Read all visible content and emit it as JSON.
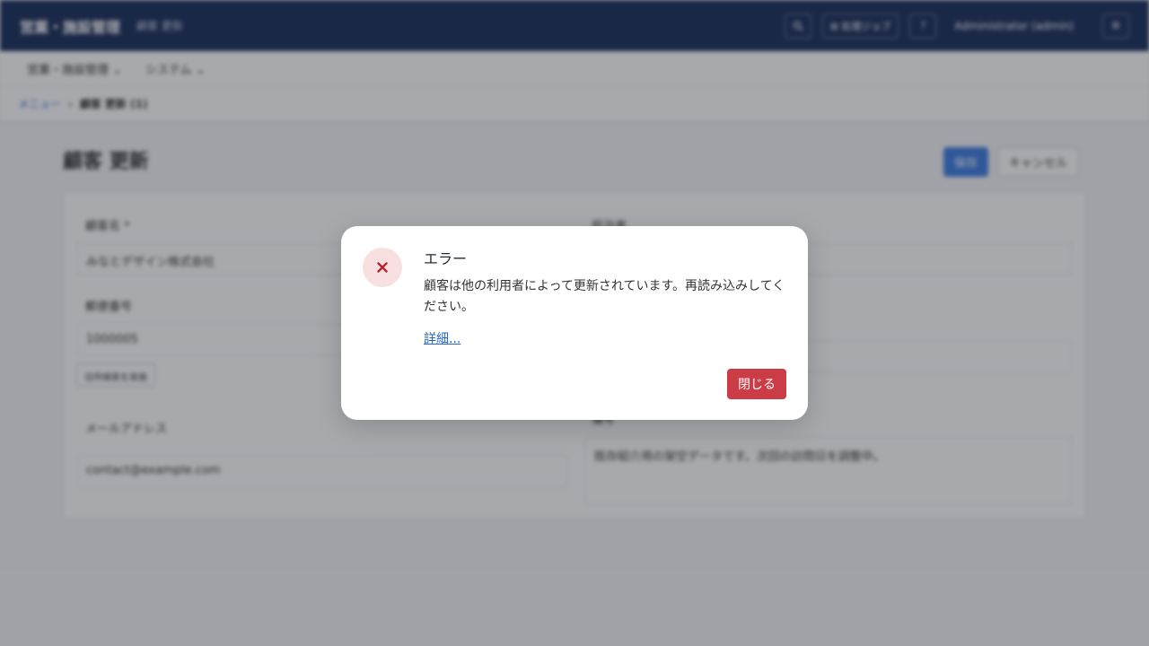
{
  "header": {
    "brand": "営業・施設管理",
    "subtitle": "顧客 更新",
    "search_icon": "search-icon",
    "jobs_label": "⊞ 処理ジョブ",
    "help_label": "?",
    "user_label": "Administrator (admin)",
    "menu_icon": "gear-icon"
  },
  "nav": {
    "items": [
      {
        "label": "営業・施設管理 ⌄"
      },
      {
        "label": "システム ⌄"
      }
    ]
  },
  "breadcrumb": {
    "root": "メニュー",
    "current": "顧客 更新 (1)"
  },
  "page": {
    "title": "顧客 更新",
    "save_label": "保存",
    "cancel_label": "キャンセル"
  },
  "form": {
    "customer_name_label": "顧客名 *",
    "customer_name_value": "みなとデザイン株式会社",
    "postal_label": "郵便番号",
    "postal_value": "1000005",
    "address_search_label": "住所検索を実施",
    "email_label": "メールアドレス",
    "email_value": "contact@example.com",
    "person_label": "担当者",
    "notes_label": "備考",
    "notes_value": "既存紹介用の架空データです。次回の訪問日を調整中。"
  },
  "dialog": {
    "title": "エラー",
    "message": "顧客は他の利用者によって更新されています。再読み込みしてください。",
    "details_link": "詳細...",
    "close_label": "閉じる",
    "icon": "error-x-icon",
    "accent_color": "#cc3c47"
  }
}
